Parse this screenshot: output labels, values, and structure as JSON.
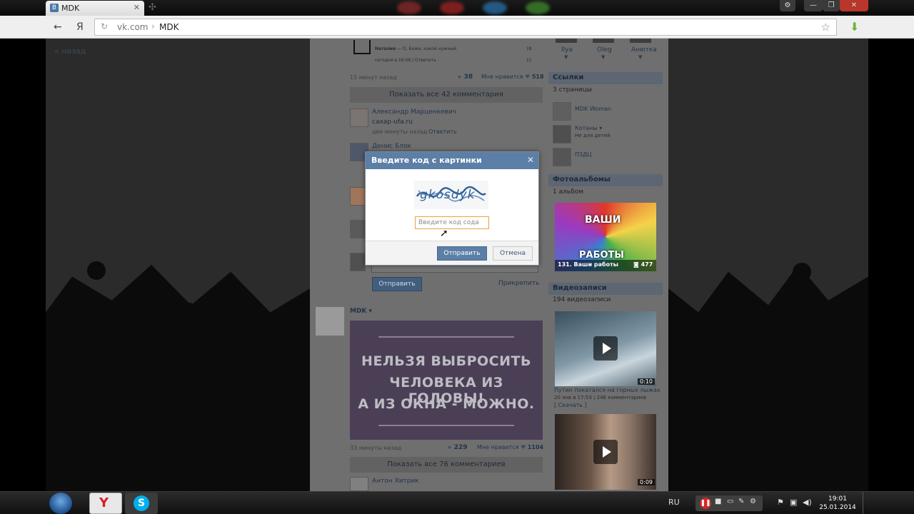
{
  "browser": {
    "tab_title": "MDK",
    "tab_favicon": "B",
    "url_host": "vk.com",
    "url_path": "MDK",
    "separator": "›",
    "yandex_letter": "Я"
  },
  "page": {
    "back_link": "« назад"
  },
  "wall": {
    "top_post": {
      "comment_author": "Наталия",
      "comment_text": "О, Боже, какой нужный",
      "comment_meta": "сегодня в 16:08",
      "comment_reply": "Ответить",
      "likes_small": "18",
      "likes_small2": "11",
      "time": "15 минут назад",
      "shares": "38",
      "likes_label": "Мне нравится",
      "likes": "518",
      "show_all": "Показать все 42 комментария"
    },
    "comments": [
      {
        "author": "Александр Марценкевич",
        "text": "caxap-ufa.ru",
        "meta": "две минуты назад",
        "reply": "Ответить"
      },
      {
        "author": "Денис Блок"
      }
    ],
    "reply_box": {
      "send": "Отправить",
      "attach": "Прикрепить"
    },
    "post2": {
      "author": "MDK",
      "poster_lines": [
        "НЕЛЬЗЯ ВЫБРОСИТЬ",
        "ЧЕЛОВЕКА ИЗ ГОЛОВЫ!",
        "А ИЗ ОКНА - МОЖНО."
      ],
      "time": "33 минуты назад",
      "shares": "229",
      "likes_label": "Мне нравится",
      "likes": "1104",
      "show_all": "Показать все 76 комментариев",
      "comment_author": "Антон Хитрик"
    }
  },
  "sidebar": {
    "friends": [
      "Ilya",
      "Oleg",
      "Анютка"
    ],
    "links_title": "Ссылки",
    "links_count": "3 страницы",
    "links": [
      {
        "name": "MDK Woman",
        "desc": ""
      },
      {
        "name": "Котаны",
        "desc": "Не для детей"
      },
      {
        "name": "ПЗДЦ",
        "desc": ""
      }
    ],
    "albums_title": "Фотоальбомы",
    "albums_count": "1 альбом",
    "album_top": "ВАШИ",
    "album_bottom": "РАБОТЫ",
    "album_caption": "131. Ваши работы",
    "album_photos": "477",
    "videos_title": "Видеозаписи",
    "videos_count": "194 видеозаписи",
    "video1_duration": "0:10",
    "video1_title": "Путин покатался на горных лыжах",
    "video1_meta": "20 янв в 17:53",
    "video1_comments": "246 комментариев",
    "video1_download": "[ Скачать ]",
    "video2_duration": "0:09"
  },
  "dialog": {
    "title": "Введите код с картинки",
    "captcha_text": "gkosdyk",
    "input_placeholder": "Введите код сода",
    "submit": "Отправить",
    "cancel": "Отмена"
  },
  "taskbar": {
    "lang": "RU",
    "time": "19:01",
    "date": "25.01.2014"
  }
}
